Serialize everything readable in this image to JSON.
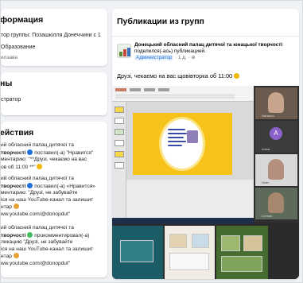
{
  "info": {
    "title": "формация",
    "line1": "тор группы: Позашкілля Донеччини с 1",
    "line2": "Образование",
    "line3": "илзава"
  },
  "admins": {
    "title": "ны",
    "line1": "стратор"
  },
  "activity": {
    "title": "ействия",
    "items": [
      {
        "l1": "ий обласний палац дитячої та",
        "l2": "творчості",
        "l2b": "поставил(-а) \"Нравится\"",
        "l3": "ментарию: \"**Друзі, чекаємо на вас",
        "l4": "ов об 11:00 **\""
      },
      {
        "l1": "ий обласний палац дитячої та",
        "l2": "творчості",
        "l2b": "поставил(-а) «Нравится»",
        "l3": "ментарию: \"Друзі, не забувайте",
        "l4": "іся на наш YouTube-канал та залишит",
        "l5": "нтар",
        "l6": "ww.youtube.com/@donopdut\""
      },
      {
        "l1": "ий обласний палац дитячої та",
        "l2": "творчості",
        "l2b": "прокомментировал(-а)",
        "l3": "ликацию \"Друзі, не забувайте",
        "l4": "іся на наш YouTube-канал та залишит",
        "l5": "нтар",
        "l6": "ww.youtube.com/@donopdut\""
      }
    ]
  },
  "feed": {
    "title": "Публикации из групп",
    "post": {
      "author": "Донецький обласний палац дитячої та юнацької творчості",
      "verb": "поделился(-ась) публикацией.",
      "role": "Администратор",
      "time": "1 д.",
      "text": "Друзі, чекаємо на вас щовівторка об 11:00"
    },
    "tiles": [
      "Наталья",
      "Аліна",
      "Олег",
      "Степан"
    ],
    "avatar_letter": "A"
  },
  "colors": {
    "accent": "#216fdb",
    "slide": "#f7c21a"
  }
}
